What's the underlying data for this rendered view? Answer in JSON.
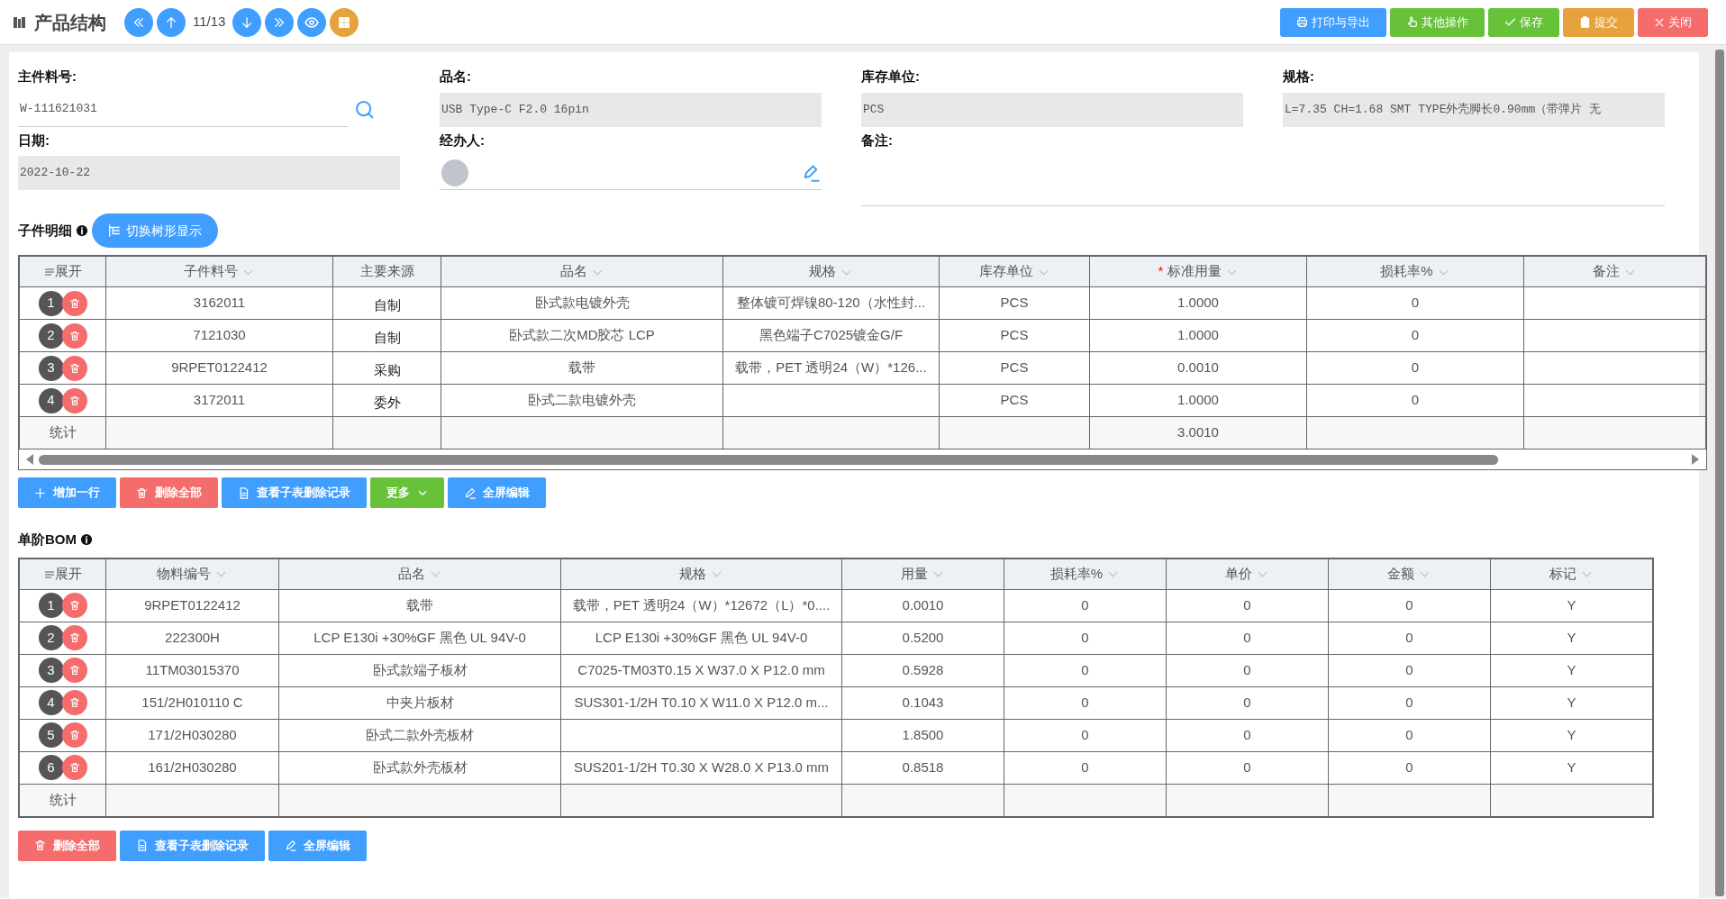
{
  "header": {
    "title": "产品结构"
  },
  "nav": [
    {
      "kind": "first"
    },
    {
      "kind": "prev"
    },
    {
      "kind": "pager",
      "text": "11/13"
    },
    {
      "kind": "next"
    },
    {
      "kind": "last"
    },
    {
      "kind": "view"
    },
    {
      "kind": "layout"
    }
  ],
  "actions": [
    {
      "label": "打印与导出",
      "kind": "print"
    },
    {
      "label": "其他操作",
      "kind": "other"
    },
    {
      "label": "保存",
      "kind": "save"
    },
    {
      "label": "提交",
      "kind": "submit"
    },
    {
      "label": "关闭",
      "kind": "close"
    }
  ],
  "form": {
    "fields": [
      {
        "label": "主件料号:",
        "value": "W-111621031",
        "kind": "lookup"
      },
      {
        "label": "品名:",
        "value": "USB Type-C F2.0 16pin",
        "kind": "readonly"
      },
      {
        "label": "库存单位:",
        "value": "PCS",
        "kind": "readonly"
      },
      {
        "label": "规格:",
        "value": "L=7.35 CH=1.68 SMT TYPE外壳脚长0.90mm（带弹片 无",
        "kind": "readonly"
      },
      {
        "label": "日期:",
        "value": "2022-10-22",
        "kind": "readonly"
      },
      {
        "label": "经办人:",
        "kind": "person"
      },
      {
        "label": "备注:",
        "kind": "remark"
      }
    ]
  },
  "sections": [
    {
      "title": "子件明细",
      "toggle_button": "切换树形显示",
      "horizontal_scrollbar": true,
      "columns": [
        {
          "label": "展开",
          "kind": "expand"
        },
        {
          "label": "子件料号",
          "sortable": true
        },
        {
          "label": "主要来源",
          "sortable": false,
          "kind": "select"
        },
        {
          "label": "品名",
          "sortable": true
        },
        {
          "label": "规格",
          "sortable": true
        },
        {
          "label": "库存单位",
          "sortable": true
        },
        {
          "label": "标准用量",
          "sortable": true,
          "required_mark": "*",
          "total": "3.0010"
        },
        {
          "label": "损耗率%",
          "sortable": true
        },
        {
          "label": "备注",
          "sortable": true
        }
      ],
      "total_label": "统计",
      "rows": [
        {
          "cells": [
            "1",
            "3162011",
            "自制",
            "卧式款电镀外壳",
            "整体镀可焊镍80-120（水性封...",
            "PCS",
            "1.0000",
            "0",
            ""
          ]
        },
        {
          "cells": [
            "2",
            "7121030",
            "自制",
            "卧式款二次MD胶芯 LCP",
            "黑色端子C7025镀金G/F",
            "PCS",
            "1.0000",
            "0",
            ""
          ]
        },
        {
          "cells": [
            "3",
            "9RPET0122412",
            "采购",
            "载带",
            "载带，PET 透明24（W）*126...",
            "PCS",
            "0.0010",
            "0",
            ""
          ]
        },
        {
          "cells": [
            "4",
            "3172011",
            "委外",
            "卧式二款电镀外壳",
            "",
            "PCS",
            "1.0000",
            "0",
            ""
          ]
        }
      ],
      "buttons": [
        {
          "label": "增加一行",
          "kind": "add"
        },
        {
          "label": "删除全部",
          "kind": "delete"
        },
        {
          "label": "查看子表删除记录",
          "kind": "log"
        },
        {
          "label": "更多",
          "kind": "more"
        },
        {
          "label": "全屏编辑",
          "kind": "fullscreen"
        }
      ]
    },
    {
      "title": "单阶BOM",
      "horizontal_scrollbar": false,
      "columns": [
        {
          "label": "展开",
          "kind": "expand"
        },
        {
          "label": "物料编号",
          "sortable": true
        },
        {
          "label": "品名",
          "sortable": true
        },
        {
          "label": "规格",
          "sortable": true
        },
        {
          "label": "用量",
          "sortable": true
        },
        {
          "label": "损耗率%",
          "sortable": true
        },
        {
          "label": "单价",
          "sortable": true
        },
        {
          "label": "金额",
          "sortable": true
        },
        {
          "label": "标记",
          "sortable": true,
          "kind": "flag"
        }
      ],
      "total_label": "统计",
      "rows": [
        {
          "cells": [
            "1",
            "9RPET0122412",
            "载带",
            "载带，PET 透明24（W）*12672（L）*0....",
            "0.0010",
            "0",
            "0",
            "0",
            "Y"
          ]
        },
        {
          "cells": [
            "2",
            "222300H",
            "LCP E130i +30%GF 黑色 UL 94V-0",
            "LCP E130i +30%GF 黑色 UL 94V-0",
            "0.5200",
            "0",
            "0",
            "0",
            "Y"
          ]
        },
        {
          "cells": [
            "3",
            "11TM03015370",
            "卧式款端子板材",
            "C7025-TM03T0.15 X W37.0 X P12.0 mm",
            "0.5928",
            "0",
            "0",
            "0",
            "Y"
          ]
        },
        {
          "cells": [
            "4",
            "151/2H010110 C",
            "中夹片板材",
            "SUS301-1/2H T0.10 X W11.0 X P12.0 m...",
            "0.1043",
            "0",
            "0",
            "0",
            "Y"
          ]
        },
        {
          "cells": [
            "5",
            "171/2H030280",
            "卧式二款外壳板材",
            "",
            "1.8500",
            "0",
            "0",
            "0",
            "Y"
          ]
        },
        {
          "cells": [
            "6",
            "161/2H030280",
            "卧式款外壳板材",
            "SUS201-1/2H T0.30 X W28.0 X P13.0 mm",
            "0.8518",
            "0",
            "0",
            "0",
            "Y"
          ]
        }
      ],
      "buttons": [
        {
          "label": "删除全部",
          "kind": "delete"
        },
        {
          "label": "查看子表删除记录",
          "kind": "log"
        },
        {
          "label": "全屏编辑",
          "kind": "fullscreen"
        }
      ]
    }
  ]
}
